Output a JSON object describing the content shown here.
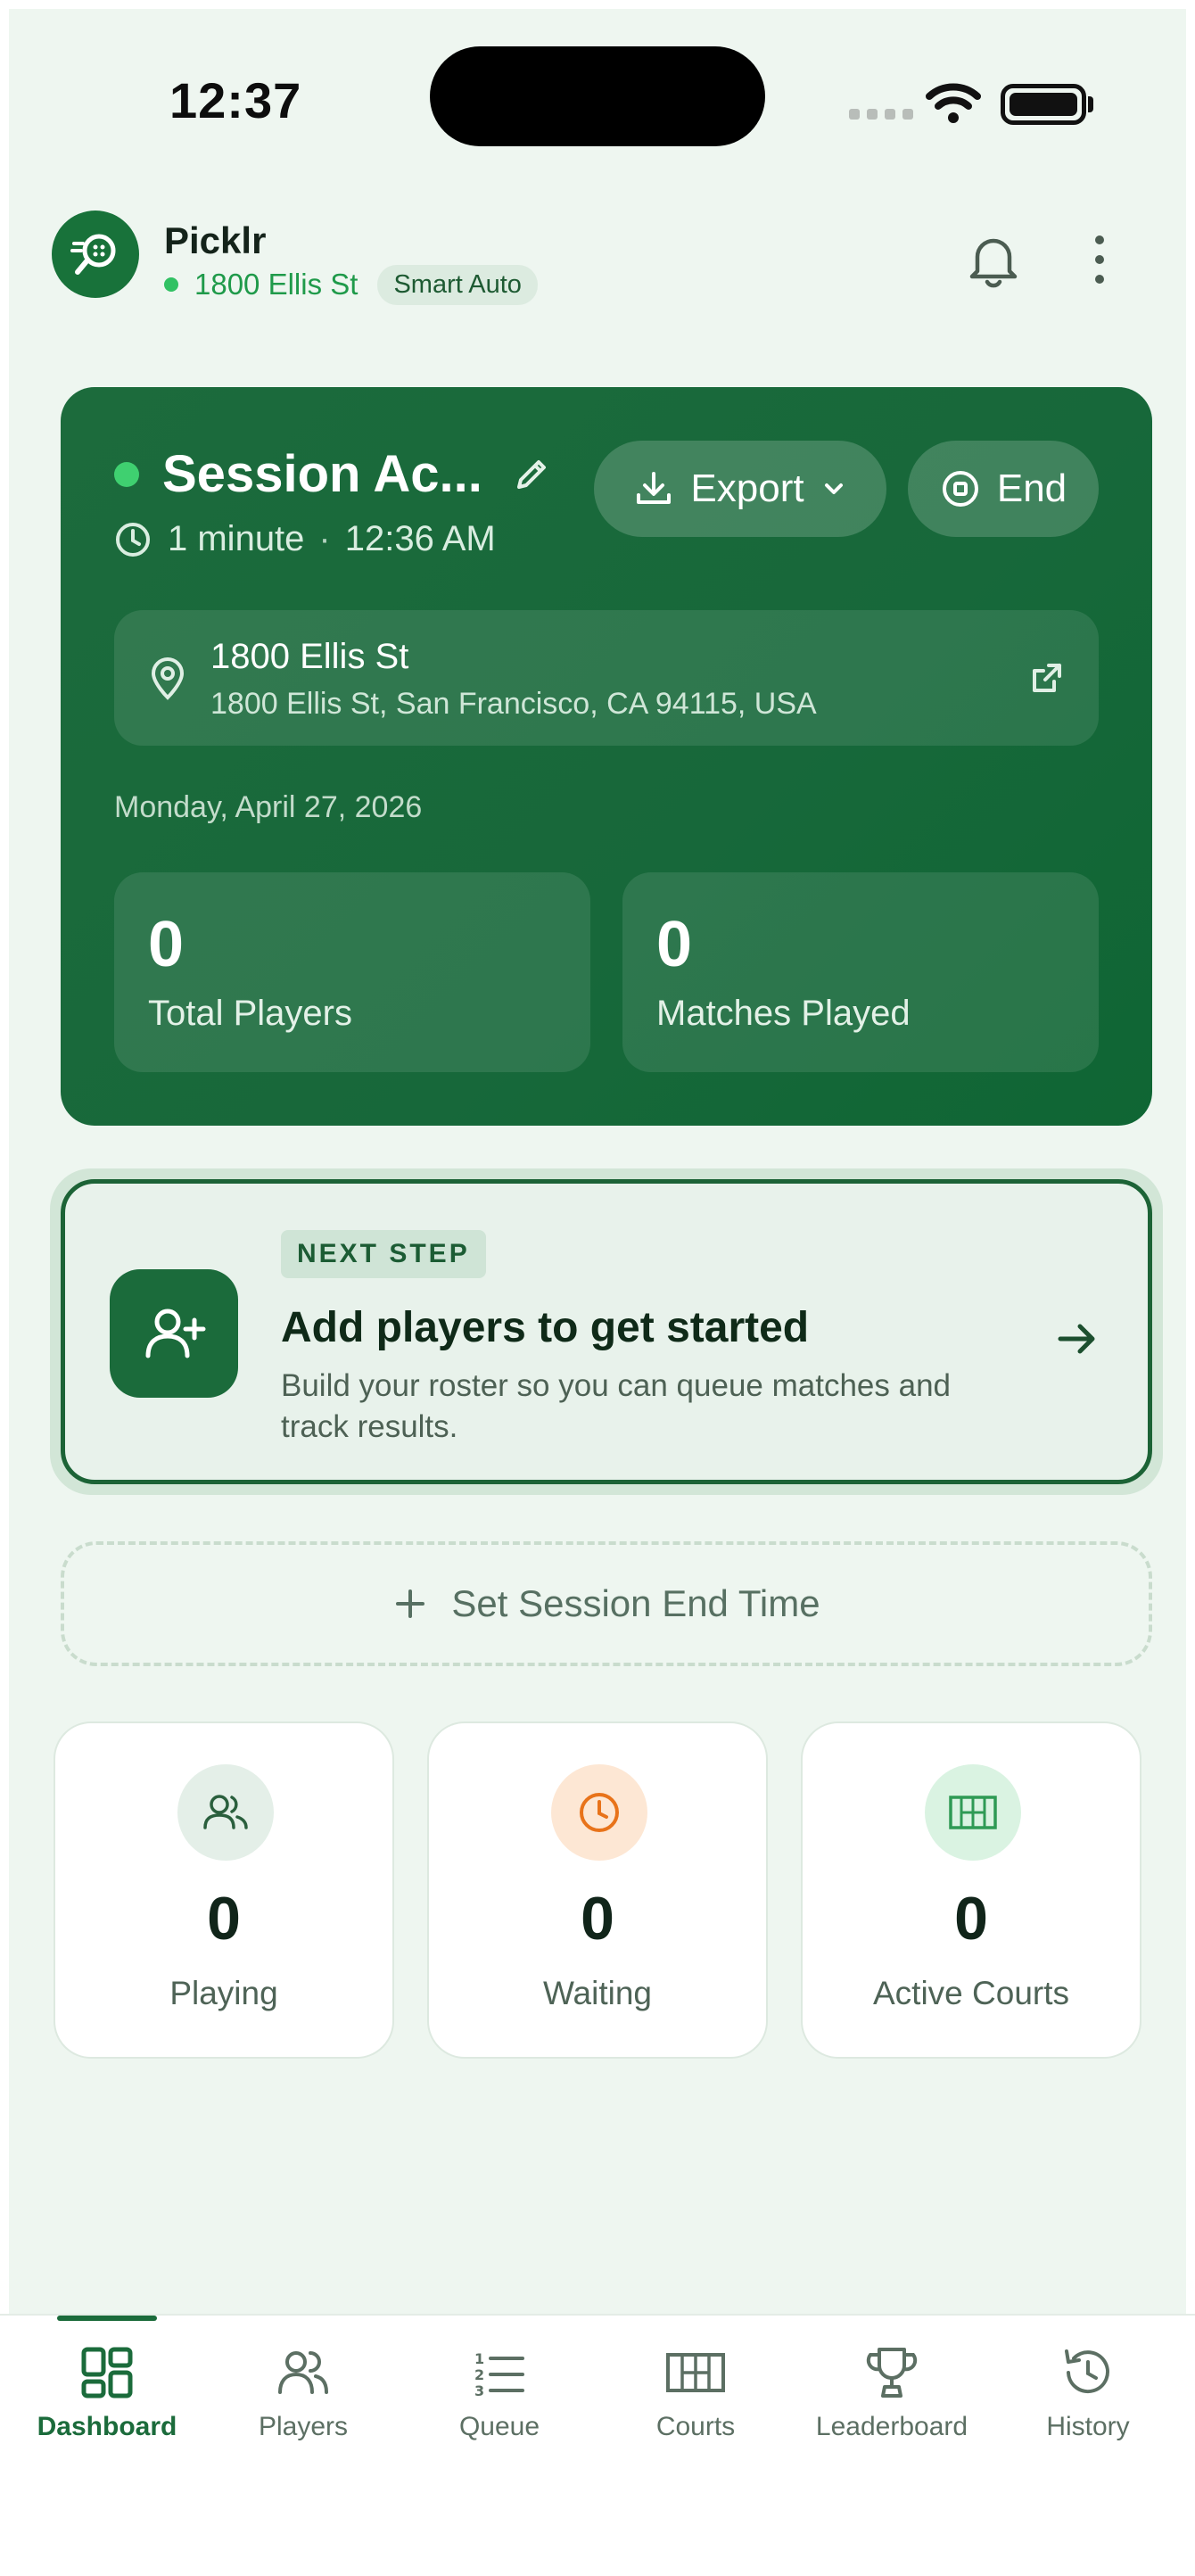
{
  "status_bar": {
    "time": "12:37"
  },
  "header": {
    "app_name": "Picklr",
    "venue": "1800 Ellis St",
    "mode_badge": "Smart Auto"
  },
  "session": {
    "title": "Session Ac...",
    "duration": "1 minute",
    "start_time": "12:36 AM",
    "export_label": "Export",
    "end_label": "End",
    "location_name": "1800 Ellis St",
    "location_address": "1800 Ellis St, San Francisco, CA 94115, USA",
    "date": "Monday, April 27, 2026",
    "stats": [
      {
        "value": "0",
        "label": "Total Players"
      },
      {
        "value": "0",
        "label": "Matches Played"
      }
    ]
  },
  "next_step": {
    "badge": "NEXT STEP",
    "title": "Add players to get started",
    "description": "Build your roster so you can queue matches and track results."
  },
  "set_end_time_label": "Set Session End Time",
  "mini_stats": [
    {
      "value": "0",
      "label": "Playing",
      "icon": "users-icon",
      "color": "#2a5f3d"
    },
    {
      "value": "0",
      "label": "Waiting",
      "icon": "clock-icon",
      "color": "#e8731a"
    },
    {
      "value": "0",
      "label": "Active Courts",
      "icon": "court-icon",
      "color": "#2f9a55"
    }
  ],
  "tabs": [
    {
      "label": "Dashboard",
      "icon": "dashboard-icon",
      "active": true
    },
    {
      "label": "Players",
      "icon": "players-icon"
    },
    {
      "label": "Queue",
      "icon": "queue-icon"
    },
    {
      "label": "Courts",
      "icon": "courts-icon"
    },
    {
      "label": "Leaderboard",
      "icon": "trophy-icon"
    },
    {
      "label": "History",
      "icon": "history-icon"
    }
  ],
  "colors": {
    "brand": "#1b6b3b",
    "live": "#31c163",
    "background": "#eef6f0"
  }
}
